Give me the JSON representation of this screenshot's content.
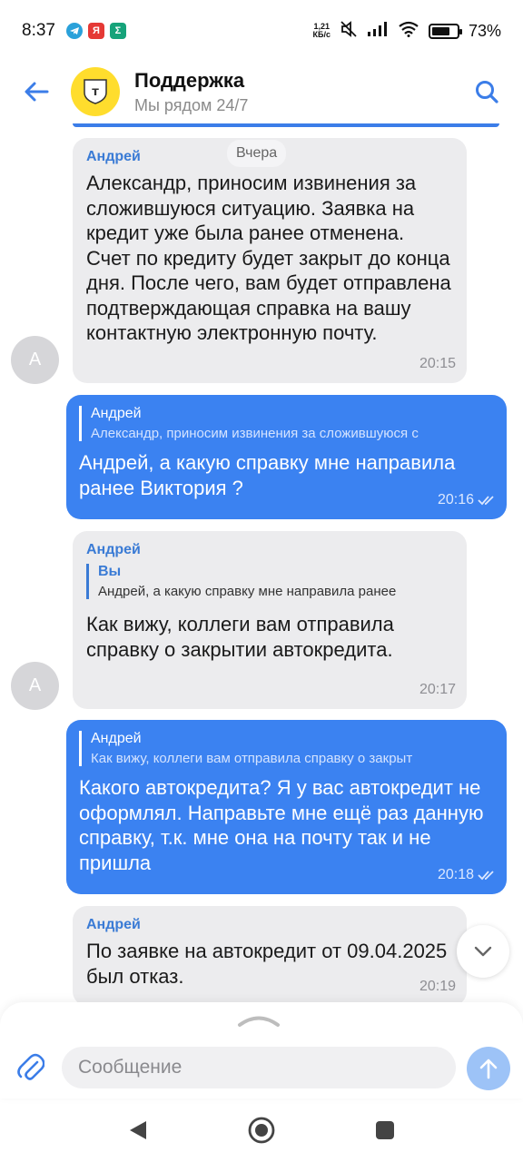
{
  "status_bar": {
    "time": "8:37",
    "net_speed_value": "1,21",
    "net_speed_unit": "КБ/с",
    "battery": "73%",
    "battery_level": 0.73
  },
  "header": {
    "title": "Поддержка",
    "subtitle": "Мы рядом 24/7",
    "logo_letter": "т"
  },
  "date_chip": "Вчера",
  "messages": [
    {
      "sender": "Андрей",
      "text": "Александр, приносим извинения за сложившуюся ситуацию. Заявка на кредит уже была ранее отменена. Счет по кредиту будет закрыт до конца дня. После чего, вам будет отправлена подтверждающая справка на вашу контактную электронную почту.",
      "time": "20:15",
      "avatar_letter": "А"
    },
    {
      "quote_author": "Андрей",
      "quote_text": "Александр, приносим извинения за сложившуюся с",
      "text": "Андрей, а какую справку мне направила ранее Виктория ?",
      "time": "20:16"
    },
    {
      "sender": "Андрей",
      "quote_author": "Вы",
      "quote_text": "Андрей, а какую справку мне направила ранее",
      "text": "Как вижу, коллеги вам отправила справку о закрытии автокредита.",
      "time": "20:17",
      "avatar_letter": "А"
    },
    {
      "quote_author": "Андрей",
      "quote_text": "Как вижу, коллеги вам отправила справку о закрыт",
      "text": "Какого автокредита? Я у вас автокредит не оформлял. Направьте мне ещё раз данную справку, т.к. мне она на почту так и не пришла",
      "time": "20:18"
    },
    {
      "sender": "Андрей",
      "text": "По заявке на автокредит от 09.04.2025 был отказ.",
      "time": "20:19"
    }
  ],
  "composer": {
    "placeholder": "Сообщение"
  },
  "icons": {
    "back": "arrow-left-icon",
    "search": "search-icon",
    "attach": "paperclip-icon",
    "send": "arrow-up-icon",
    "scroll": "chevron-down-icon"
  },
  "colors": {
    "accent": "#3b82f1",
    "incoming_bubble": "#ececee",
    "logo_yellow": "#ffdd2d"
  }
}
